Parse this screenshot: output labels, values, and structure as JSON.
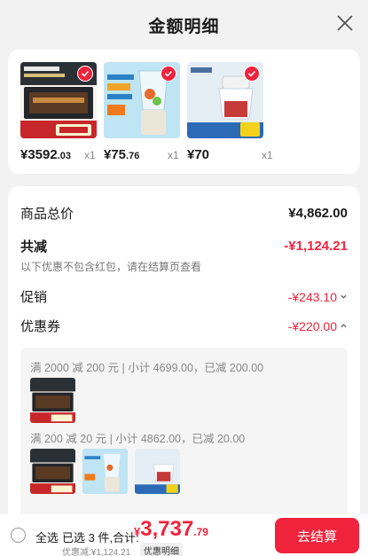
{
  "header": {
    "title": "金额明细",
    "close_icon": "close-icon"
  },
  "products": [
    {
      "name": "oven",
      "price_int": "¥3592",
      "price_dec": ".03",
      "qty": "x1",
      "thumb_colors": [
        "#2b3035",
        "#c7272b"
      ]
    },
    {
      "name": "blender",
      "price_int": "¥75",
      "price_dec": ".76",
      "qty": "x1",
      "thumb_colors": [
        "#8fcbe8",
        "#e9e3d6"
      ]
    },
    {
      "name": "chopper",
      "price_int": "¥70",
      "price_dec": "",
      "qty": "x1",
      "thumb_colors": [
        "#e6eef5",
        "#c63a3a"
      ]
    }
  ],
  "summary": {
    "total_label": "商品总价",
    "total_value": "¥4,862.00",
    "reduce_label": "共减",
    "reduce_value": "-¥1,124.21",
    "reduce_note": "以下优惠不包含红包，请在结算页查看",
    "promo_label": "促销",
    "promo_value": "-¥243.10",
    "coupon_label": "优惠券",
    "coupon_value": "-¥220.00"
  },
  "discounts": [
    {
      "title": "满 2000 减 200 元 | 小计 4699.00，已减 200.00",
      "items": [
        "oven"
      ]
    },
    {
      "title": "满 200 减 20 元 | 小计 4862.00，已减 20.00",
      "items": [
        "oven",
        "blender",
        "chopper"
      ]
    }
  ],
  "footer": {
    "select_all": "全选",
    "selected_text": "已选 3 件,合计:",
    "currency": "¥",
    "total_int": "3,737",
    "total_dec": ".79",
    "saved_text": "优惠减:¥1,124.21",
    "detail_button": "优惠明细",
    "checkout_button": "去结算"
  },
  "colors": {
    "accent": "#f0233c"
  }
}
